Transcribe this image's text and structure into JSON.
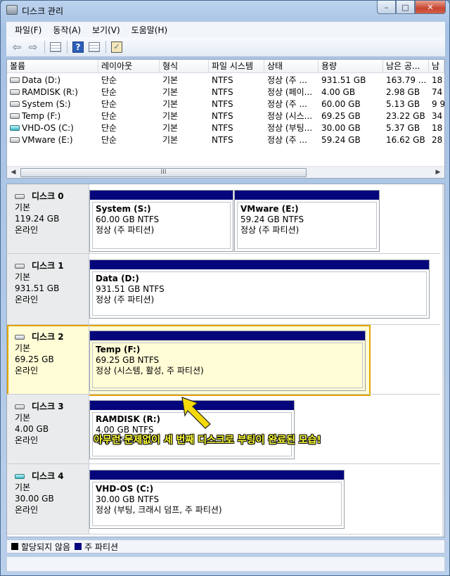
{
  "window": {
    "title": "디스크 관리",
    "btn_min": "–",
    "btn_max": "□",
    "btn_close": "✕"
  },
  "menu": [
    "파일(F)",
    "동작(A)",
    "보기(V)",
    "도움말(H)"
  ],
  "toolbar": {
    "icons": [
      "back-arrow-icon",
      "forward-arrow-icon",
      "console-tree-icon",
      "help-icon",
      "volume-list-icon",
      "properties-icon"
    ],
    "back": "⇦",
    "forward": "⇨",
    "help": "?"
  },
  "volumes": {
    "columns": [
      "볼륨",
      "레이아웃",
      "형식",
      "파일 시스템",
      "상태",
      "용량",
      "남은 공...",
      "남"
    ],
    "rows": [
      {
        "name": "Data (D:)",
        "layout": "단순",
        "type": "기본",
        "fs": "NTFS",
        "status": "정상 (주 ...",
        "capacity": "931.51 GB",
        "free": "163.79 ...",
        "pct": "18",
        "icon": "drive-icon"
      },
      {
        "name": "RAMDISK (R:)",
        "layout": "단순",
        "type": "기본",
        "fs": "NTFS",
        "status": "정상 (페이...",
        "capacity": "4.00 GB",
        "free": "2.98 GB",
        "pct": "74",
        "icon": "drive-icon"
      },
      {
        "name": "System (S:)",
        "layout": "단순",
        "type": "기본",
        "fs": "NTFS",
        "status": "정상 (주 ...",
        "capacity": "60.00 GB",
        "free": "5.13 GB",
        "pct": "9 9",
        "icon": "drive-icon"
      },
      {
        "name": "Temp (F:)",
        "layout": "단순",
        "type": "기본",
        "fs": "NTFS",
        "status": "정상 (시스...",
        "capacity": "69.25 GB",
        "free": "23.22 GB",
        "pct": "34",
        "icon": "drive-icon"
      },
      {
        "name": "VHD-OS (C:)",
        "layout": "단순",
        "type": "기본",
        "fs": "NTFS",
        "status": "정상 (부팅...",
        "capacity": "30.00 GB",
        "free": "5.37 GB",
        "pct": "18",
        "icon": "vhd-drive-icon"
      },
      {
        "name": "VMware (E:)",
        "layout": "단순",
        "type": "기본",
        "fs": "NTFS",
        "status": "정상 (주 ...",
        "capacity": "59.24 GB",
        "free": "16.62 GB",
        "pct": "28",
        "icon": "drive-icon"
      }
    ],
    "scroll_grip": "III",
    "arrow_left": "◀",
    "arrow_right": "▶"
  },
  "disks": [
    {
      "title": "디스크 0",
      "kind": "기본",
      "size": "119.24 GB",
      "state": "온라인",
      "icon": "disk-icon",
      "partitions": [
        {
          "name": "System  (S:)",
          "detail": "60.00 GB NTFS",
          "status": "정상 (주 파티션)"
        },
        {
          "name": "VMware  (E:)",
          "detail": "59.24 GB NTFS",
          "status": "정상 (주 파티션)"
        }
      ]
    },
    {
      "title": "디스크 1",
      "kind": "기본",
      "size": "931.51 GB",
      "state": "온라인",
      "icon": "disk-icon",
      "partitions": [
        {
          "name": "Data  (D:)",
          "detail": "931.51 GB NTFS",
          "status": "정상 (주 파티션)"
        }
      ]
    },
    {
      "title": "디스크 2",
      "kind": "기본",
      "size": "69.25 GB",
      "state": "온라인",
      "icon": "disk-icon",
      "partitions": [
        {
          "name": "Temp  (F:)",
          "detail": "69.25 GB NTFS",
          "status": "정상 (시스템, 활성, 주 파티션)"
        }
      ]
    },
    {
      "title": "디스크 3",
      "kind": "기본",
      "size": "4.00 GB",
      "state": "온라인",
      "icon": "disk-icon",
      "partitions": [
        {
          "name": "RAMDISK  (R:)",
          "detail": "4.00 GB NTFS",
          "status": "정상 (주 파티션)"
        }
      ]
    },
    {
      "title": "디스크 4",
      "kind": "기본",
      "size": "30.00 GB",
      "state": "온라인",
      "icon": "vhd-disk-icon",
      "partitions": [
        {
          "name": "VHD-OS  (C:)",
          "detail": "30.00 GB NTFS",
          "status": "정상 (부팅, 크래시 덤프, 주 파티션)"
        }
      ]
    }
  ],
  "legend": [
    {
      "label": "할당되지 않음",
      "color": "#000000"
    },
    {
      "label": "주 파티션",
      "color": "#06067c"
    }
  ],
  "annotation": {
    "text": "아무런 문제없이 세 번째 디스크로 부팅이 완료된 모습!",
    "color": "#ffff3a",
    "arrow_color": "#f5d90a"
  },
  "colors": {
    "highlight": "#e5a300",
    "partition_bar": "#06067c"
  }
}
